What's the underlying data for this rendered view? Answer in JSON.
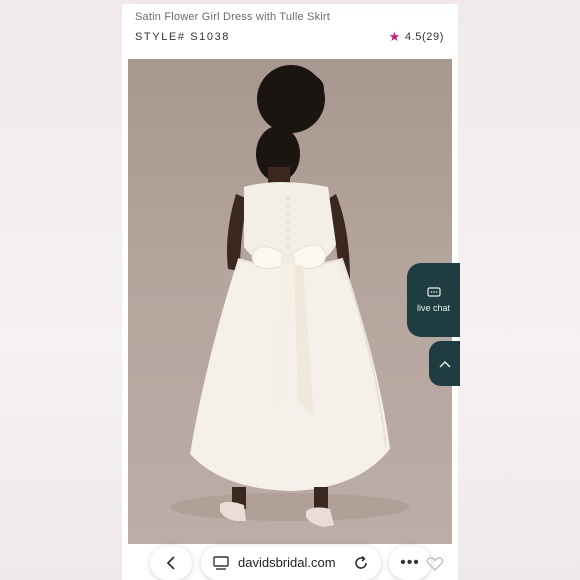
{
  "product": {
    "title": "Satin Flower Girl Dress with Tulle Skirt",
    "style": "STYLE# S1038",
    "rating": "4.5(29)"
  },
  "photo": {
    "icon": "dress-photo"
  },
  "widgets": {
    "live_chat_label": "live chat",
    "live_chat_icon": "chat-bubble-icon",
    "scroll_up_icon": "chevron-up-icon"
  },
  "browser": {
    "url": "davidsbridal.com",
    "back_icon": "chevron-left-icon",
    "reload_icon": "reload-icon",
    "more_label": "•••"
  },
  "colors": {
    "accent_star": "#d2157c",
    "chat_bg": "#1f3c40"
  }
}
